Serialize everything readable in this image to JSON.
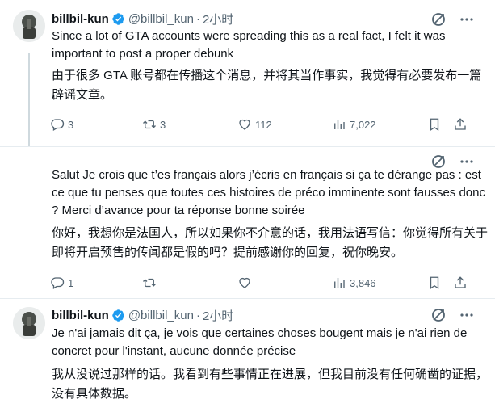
{
  "tweets": [
    {
      "author": "billbil-kun",
      "handle": "@billbil_kun",
      "dot": "·",
      "time": "2小时",
      "text": "Since a lot of GTA accounts were spreading this as a real fact, I felt it was important to post a proper debunk",
      "translation": "由于很多 GTA 账号都在传播这个消息，并将其当作事实，我觉得有必要发布一篇辟谣文章。",
      "replies": "3",
      "retweets": "3",
      "likes": "112",
      "views": "7,022"
    },
    {
      "text": "Salut Je crois que t’es français alors j’écris en français si ça te dérange pas : est ce que tu penses que toutes ces histoires de préco imminente sont fausses donc ? Merci d’avance pour ta réponse bonne soirée",
      "translation": "你好，我想你是法国人，所以如果你不介意的话，我用法语写信：你觉得所有关于即将开启预售的传闻都是假的吗？提前感谢你的回复，祝你晚安。",
      "replies": "1",
      "retweets": "",
      "likes": "",
      "views": "3,846"
    },
    {
      "author": "billbil-kun",
      "handle": "@billbil_kun",
      "dot": "·",
      "time": "2小时",
      "text": "Je n'ai jamais dit ça, je vois que certaines choses bougent mais je n'ai rien de concret pour l'instant, aucune donnée précise",
      "translation": "我从没说过那样的话。我看到有些事情正在进展，但我目前没有任何确凿的证据，没有具体数据。"
    }
  ],
  "icons": {
    "verified": "verified-badge-icon",
    "grok": "grok-icon",
    "more": "more-icon",
    "reply": "reply-icon",
    "retweet": "retweet-icon",
    "like": "heart-icon",
    "views": "views-icon",
    "bookmark": "bookmark-icon",
    "share": "share-icon"
  },
  "colors": {
    "verified": "#1d9bf0",
    "muted": "#536471",
    "text": "#0f1419"
  }
}
